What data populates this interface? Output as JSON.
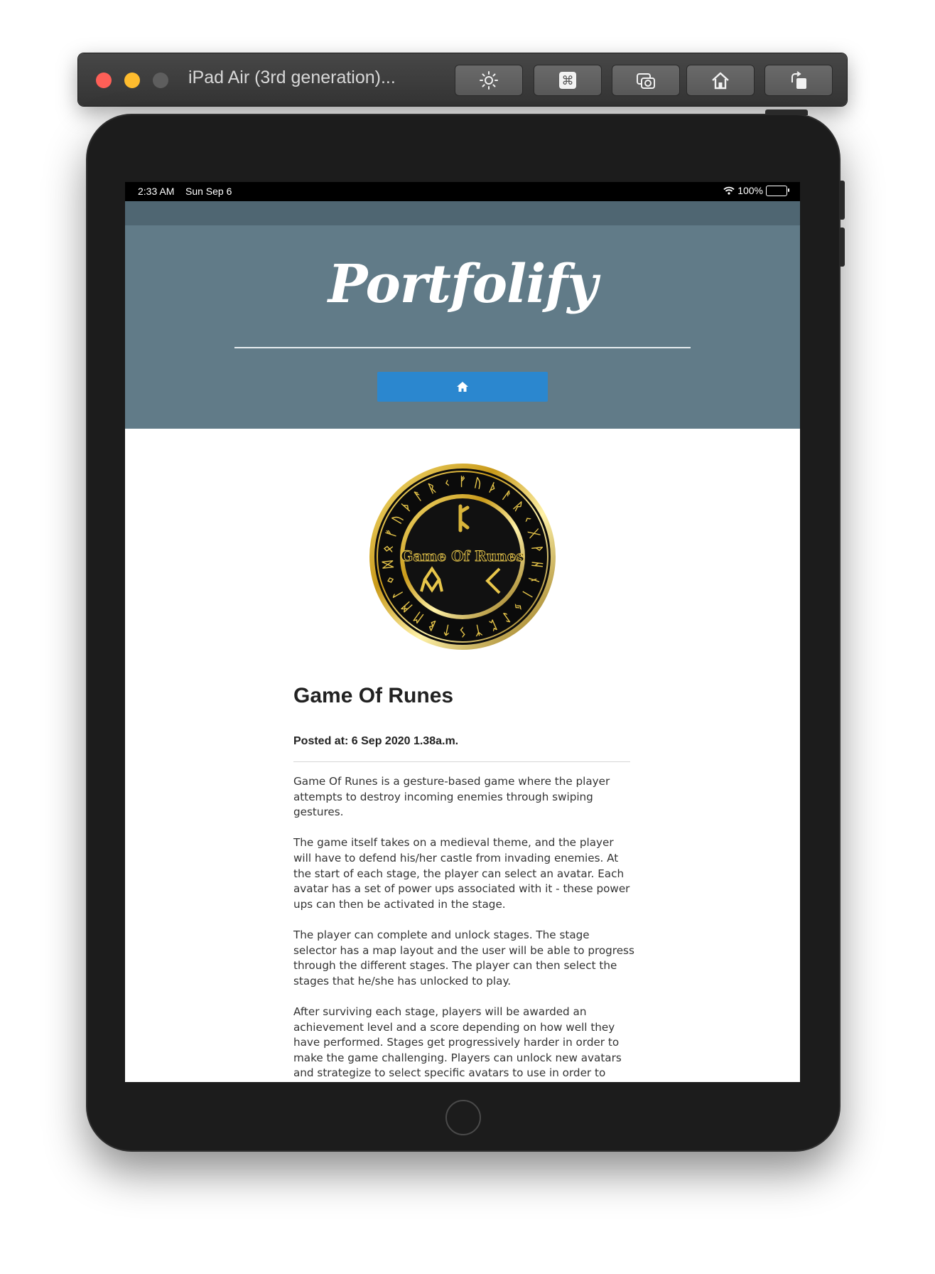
{
  "simulator": {
    "title": "iPad Air (3rd generation)...",
    "toolbar": [
      "brightness-icon",
      "command-icon",
      "screenshot-icon",
      "home-icon",
      "rotate-icon"
    ]
  },
  "status_bar": {
    "time": "2:33 AM",
    "date": "Sun Sep 6",
    "battery": "100%"
  },
  "site": {
    "brand": "Portfolify",
    "colors": {
      "header": "#617b88",
      "nav_strip": "#4f6672",
      "home_button": "#2b87cf"
    }
  },
  "logo": {
    "text": "Game Of Runes"
  },
  "post": {
    "title": "Game Of Runes",
    "meta": "Posted at: 6 Sep 2020 1.38a.m.",
    "paragraphs": [
      "Game Of Runes is a gesture-based game where the player attempts to destroy incoming enemies through swiping gestures.",
      "The game itself takes on a medieval theme, and the player will have to defend his/her castle from invading enemies. At the start of each stage, the player can select an avatar. Each avatar has a set of power ups associated with it - these power ups can then be activated in the stage.",
      "The player can complete and unlock stages. The stage selector has a map layout and the user will be able to progress through the different stages. The player can then select the stages that he/she has unlocked to play.",
      "After surviving each stage, players will be awarded an achievement level and a score depending on how well they have performed. Stages get progressively harder in order to make the game challenging. Players can unlock new avatars and strategize to select specific avatars to use in order to make"
    ]
  }
}
